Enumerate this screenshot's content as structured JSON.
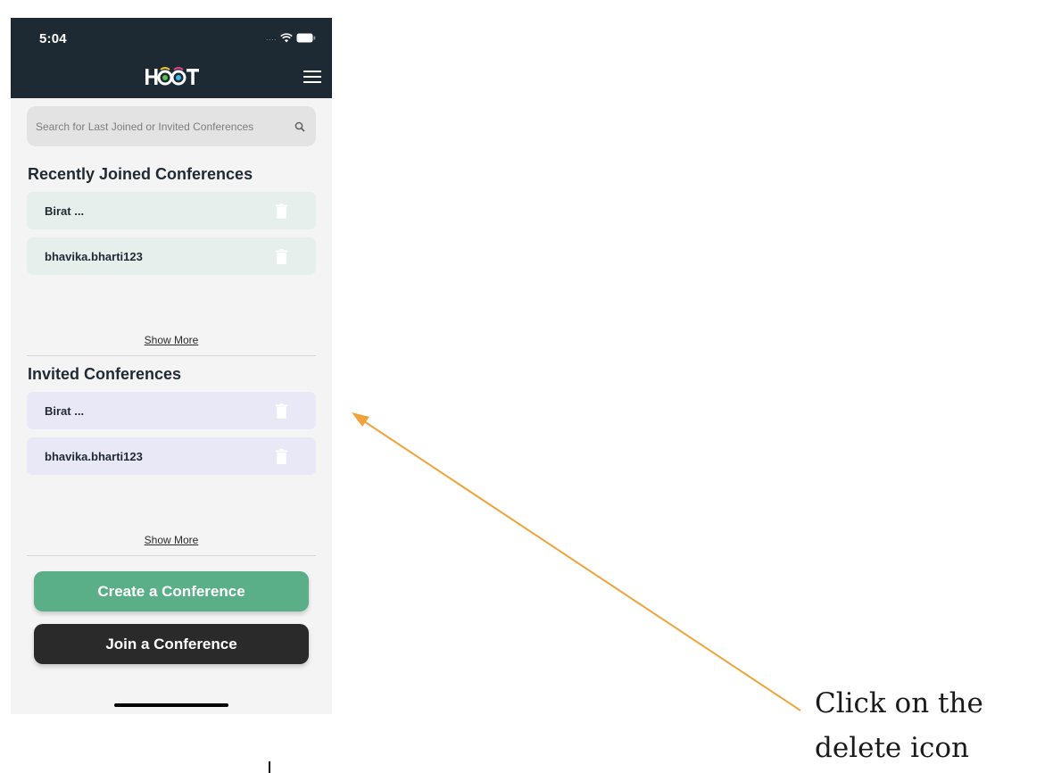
{
  "status_bar": {
    "time": "5:04",
    "signal": "....",
    "wifi_icon": "wifi-icon",
    "battery_icon": "battery-icon"
  },
  "header": {
    "logo_text": "HOOT",
    "menu_icon": "hamburger-menu-icon",
    "background_color": "#1e2a33"
  },
  "search": {
    "placeholder": "Search for Last Joined or Invited Conferences",
    "value": "",
    "icon": "search-icon"
  },
  "recent": {
    "title": "Recently Joined Conferences",
    "items": [
      {
        "name": "Birat ...",
        "icon": "trash-icon"
      },
      {
        "name": "bhavika.bharti123",
        "icon": "trash-icon"
      }
    ],
    "show_more": "Show More",
    "item_color": "#e6efeb"
  },
  "invited": {
    "title": "Invited Conferences",
    "items": [
      {
        "name": "Birat ...",
        "icon": "trash-icon"
      },
      {
        "name": "bhavika.bharti123",
        "icon": "trash-icon"
      }
    ],
    "show_more": "Show More",
    "item_color": "#e9e8f7"
  },
  "actions": {
    "create_label": "Create a Conference",
    "join_label": "Join a Conference",
    "create_color": "#5aaf88",
    "join_color": "#2a2a2a"
  },
  "annotation": {
    "text": "Click on the\ndelete icon",
    "arrow_color": "#f0a33a"
  }
}
